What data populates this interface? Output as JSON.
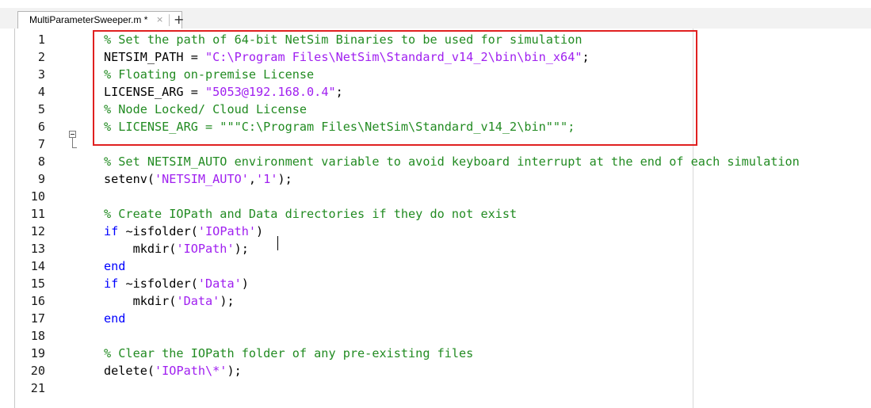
{
  "tab": {
    "title": "MultiParameterSweeper.m *",
    "close_glyph": "×",
    "add_glyph": "+"
  },
  "highlight_color": "#e02020",
  "syntax_colors": {
    "comment": "#228b22",
    "string": "#a020f0",
    "keyword": "#0000ff"
  },
  "lines": [
    {
      "num": "1",
      "tokens": [
        {
          "t": "comment",
          "v": "% Set the path of 64-bit NetSim Binaries to be used for simulation"
        }
      ]
    },
    {
      "num": "2",
      "tokens": [
        {
          "t": "plain",
          "v": "NETSIM_PATH = "
        },
        {
          "t": "string",
          "v": "\"C:\\Program Files\\NetSim\\Standard_v14_2\\bin\\bin_x64\""
        },
        {
          "t": "plain",
          "v": ";"
        }
      ]
    },
    {
      "num": "3",
      "tokens": [
        {
          "t": "comment",
          "v": "% Floating on-premise License"
        }
      ]
    },
    {
      "num": "4",
      "tokens": [
        {
          "t": "plain",
          "v": "LICENSE_ARG = "
        },
        {
          "t": "string",
          "v": "\"5053@192.168.0.4\""
        },
        {
          "t": "plain",
          "v": ";"
        }
      ]
    },
    {
      "num": "5",
      "tokens": [
        {
          "t": "comment",
          "v": "% Node Locked/ Cloud License"
        }
      ]
    },
    {
      "num": "6",
      "tokens": [
        {
          "t": "comment",
          "v": "% LICENSE_ARG = \"\"\"C:\\Program Files\\NetSim\\Standard_v14_2\\bin\"\"\";"
        }
      ]
    },
    {
      "num": "7",
      "tokens": []
    },
    {
      "num": "8",
      "tokens": [
        {
          "t": "comment",
          "v": "% Set NETSIM_AUTO environment variable to avoid keyboard interrupt at the end of each simulation"
        }
      ]
    },
    {
      "num": "9",
      "tokens": [
        {
          "t": "plain",
          "v": "setenv("
        },
        {
          "t": "string",
          "v": "'NETSIM_AUTO'"
        },
        {
          "t": "plain",
          "v": ","
        },
        {
          "t": "string",
          "v": "'1'"
        },
        {
          "t": "plain",
          "v": ");"
        }
      ]
    },
    {
      "num": "10",
      "tokens": []
    },
    {
      "num": "11",
      "tokens": [
        {
          "t": "comment",
          "v": "% Create IOPath and Data directories if they do not exist"
        }
      ]
    },
    {
      "num": "12",
      "tokens": [
        {
          "t": "keyword",
          "v": "if"
        },
        {
          "t": "plain",
          "v": " ~isfolder("
        },
        {
          "t": "string",
          "v": "'IOPath'"
        },
        {
          "t": "plain",
          "v": ")"
        }
      ]
    },
    {
      "num": "13",
      "tokens": [
        {
          "t": "plain",
          "v": "    mkdir("
        },
        {
          "t": "string",
          "v": "'IOPath'"
        },
        {
          "t": "plain",
          "v": ");"
        }
      ]
    },
    {
      "num": "14",
      "tokens": [
        {
          "t": "keyword",
          "v": "end"
        }
      ]
    },
    {
      "num": "15",
      "tokens": [
        {
          "t": "keyword",
          "v": "if"
        },
        {
          "t": "plain",
          "v": " ~isfolder("
        },
        {
          "t": "string",
          "v": "'Data'"
        },
        {
          "t": "plain",
          "v": ")"
        }
      ]
    },
    {
      "num": "16",
      "tokens": [
        {
          "t": "plain",
          "v": "    mkdir("
        },
        {
          "t": "string",
          "v": "'Data'"
        },
        {
          "t": "plain",
          "v": ");"
        }
      ]
    },
    {
      "num": "17",
      "tokens": [
        {
          "t": "keyword",
          "v": "end"
        }
      ]
    },
    {
      "num": "18",
      "tokens": []
    },
    {
      "num": "19",
      "tokens": [
        {
          "t": "comment",
          "v": "% Clear the IOPath folder of any pre-existing files"
        }
      ]
    },
    {
      "num": "20",
      "tokens": [
        {
          "t": "plain",
          "v": "delete("
        },
        {
          "t": "string",
          "v": "'IOPath\\*'"
        },
        {
          "t": "plain",
          "v": ");"
        }
      ]
    },
    {
      "num": "21",
      "tokens": []
    }
  ]
}
